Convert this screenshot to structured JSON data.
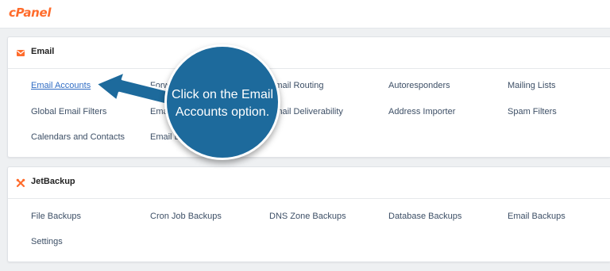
{
  "brand": {
    "logo_text": "cPanel"
  },
  "email_section": {
    "title": "Email",
    "links": [
      "Email Accounts",
      "Forwarders",
      "Email Routing",
      "Autoresponders",
      "Mailing Lists",
      "Global Email Filters",
      "Email Filters",
      "Email Deliverability",
      "Address Importer",
      "Spam Filters",
      "Calendars and Contacts",
      "Email Disk Usage"
    ]
  },
  "jetbackup_section": {
    "title": "JetBackup",
    "links": [
      "File Backups",
      "Cron Job Backups",
      "DNS Zone Backups",
      "Database Backups",
      "Email Backups",
      "Settings"
    ]
  },
  "callout": {
    "text": "Click on the Email Accounts option."
  },
  "colors": {
    "brand": "#ff6c2c",
    "callout": "#1d6a9c",
    "link": "#3d4f66",
    "active_link": "#2f6cc4",
    "icon": "#ff6c2c"
  },
  "icons": {
    "email": "envelope-icon",
    "jetbackup": "tools-icon"
  }
}
